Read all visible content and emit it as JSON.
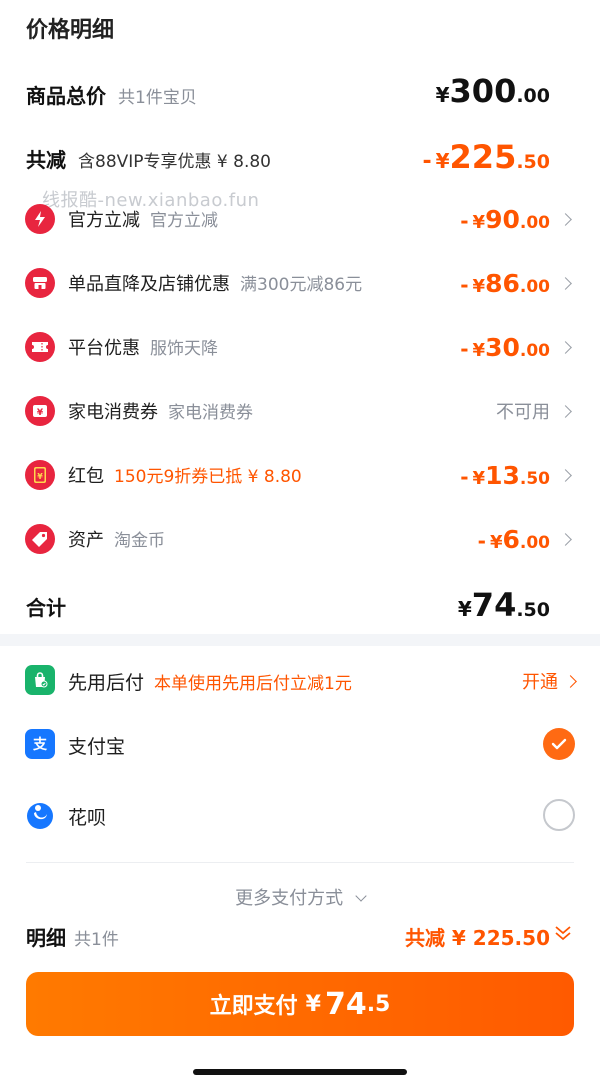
{
  "header": {
    "title": "价格明细"
  },
  "watermark": "线报酷-new.xianbao.fun",
  "total_price": {
    "label": "商品总价",
    "sub": "共1件宝贝",
    "currency": "¥",
    "int": "300",
    "dec": ".00"
  },
  "reduction": {
    "label": "共减",
    "sub": "含88VIP专享优惠 ¥ 8.80",
    "minus": "-",
    "currency": "¥",
    "int": "225",
    "dec": ".50"
  },
  "discounts": [
    {
      "icon": "lightning-icon",
      "label": "官方立减",
      "sub": "官方立减",
      "sub_orange": false,
      "minus": "-",
      "currency": "¥",
      "int": "90",
      "dec": ".00",
      "text": ""
    },
    {
      "icon": "shop-icon",
      "label": "单品直降及店铺优惠",
      "sub": "满300元减86元",
      "sub_orange": false,
      "minus": "-",
      "currency": "¥",
      "int": "86",
      "dec": ".00",
      "text": ""
    },
    {
      "icon": "ticket-icon",
      "label": "平台优惠",
      "sub": "服饰天降",
      "sub_orange": false,
      "minus": "-",
      "currency": "¥",
      "int": "30",
      "dec": ".00",
      "text": ""
    },
    {
      "icon": "voucher-icon",
      "label": "家电消费券",
      "sub": "家电消费券",
      "sub_orange": false,
      "minus": "",
      "currency": "",
      "int": "",
      "dec": "",
      "text": "不可用"
    },
    {
      "icon": "red-envelope-icon",
      "label": "红包",
      "sub": "150元9折券已抵 ¥ 8.80",
      "sub_orange": true,
      "minus": "-",
      "currency": "¥",
      "int": "13",
      "dec": ".50",
      "text": ""
    },
    {
      "icon": "tag-icon",
      "label": "资产",
      "sub": "淘金币",
      "sub_orange": false,
      "minus": "-",
      "currency": "¥",
      "int": "6",
      "dec": ".00",
      "text": ""
    }
  ],
  "sum": {
    "label": "合计",
    "currency": "¥",
    "int": "74",
    "dec": ".50"
  },
  "payment_methods": {
    "pay_later": {
      "label": "先用后付",
      "promo": "本单使用先用后付立减1元",
      "action": "开通"
    },
    "alipay": {
      "label": "支付宝",
      "selected": true
    },
    "huabei": {
      "label": "花呗",
      "selected": false
    },
    "more": "更多支付方式"
  },
  "footer": {
    "detail_label": "明细",
    "detail_sub": "共1件",
    "detail_total": "共减 ¥ 225.50",
    "pay_button": {
      "label": "立即支付",
      "currency": "¥",
      "int": "74",
      "dec": ".5"
    }
  },
  "colors": {
    "accent": "#ff5500",
    "icon_red": "#e8253f",
    "alipay_blue": "#1677ff",
    "green": "#19b36b"
  }
}
